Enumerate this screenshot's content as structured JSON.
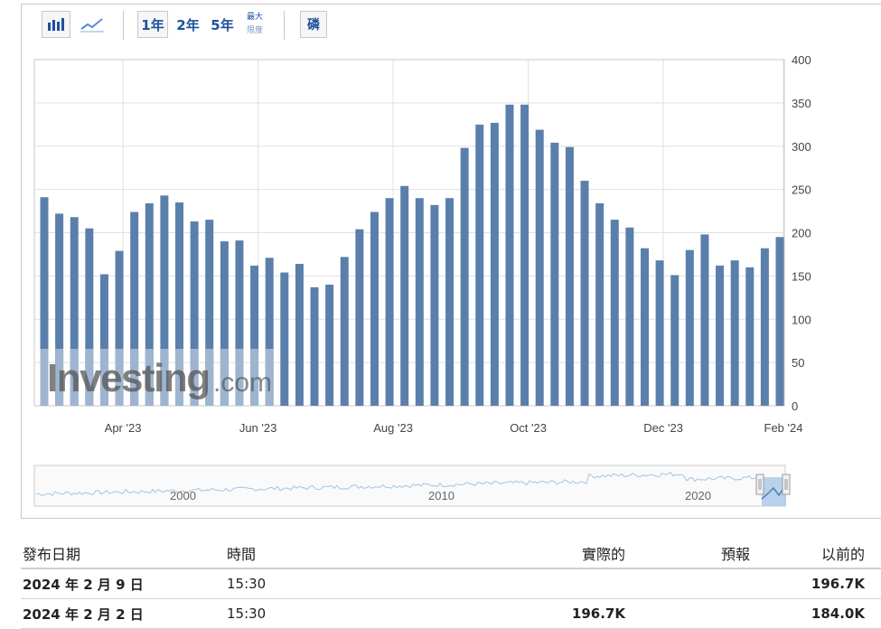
{
  "toolbar": {
    "bar_chart_icon": "bar-chart-icon",
    "line_chart_icon": "line-chart-icon",
    "range_1y": "1年",
    "range_2y": "2年",
    "range_5y": "5年",
    "range_max": "最大",
    "range_max_sub": "限度",
    "extra_button": "磷"
  },
  "watermark": {
    "brand": "Investing",
    "domain": ".com"
  },
  "colors": {
    "bar": "#5b7fab",
    "bar_watermark": "#9fb5cf",
    "navigator_fill": "#a8c8e8",
    "grid": "#e0e0e0"
  },
  "chart_data": {
    "type": "bar",
    "x_tick_labels": [
      "Apr '23",
      "Jun '23",
      "Aug '23",
      "Oct '23",
      "Dec '23",
      "Feb '24"
    ],
    "y_ticks": [
      0,
      50,
      100,
      150,
      200,
      250,
      300,
      350,
      400
    ],
    "ylim": [
      0,
      400
    ],
    "values": [
      241,
      222,
      218,
      205,
      152,
      179,
      224,
      234,
      243,
      235,
      213,
      215,
      190,
      191,
      162,
      171,
      154,
      164,
      137,
      140,
      172,
      204,
      224,
      240,
      254,
      240,
      232,
      240,
      298,
      325,
      327,
      348,
      348,
      319,
      304,
      299,
      260,
      234,
      215,
      206,
      182,
      168,
      151,
      180,
      198,
      162,
      168,
      160,
      182,
      195
    ],
    "navigator": {
      "labels": [
        "2000",
        "2010",
        "2020"
      ]
    },
    "grid": true
  },
  "table": {
    "headers": {
      "date": "發布日期",
      "time": "時間",
      "actual": "實際的",
      "forecast": "預報",
      "previous": "以前的"
    },
    "rows": [
      {
        "date": "2024 年 2 月 9 日",
        "time": "15:30",
        "actual": "",
        "forecast": "",
        "previous": "196.7K"
      },
      {
        "date": "2024 年 2 月 2 日",
        "time": "15:30",
        "actual": "196.7K",
        "forecast": "",
        "previous": "184.0K"
      }
    ]
  }
}
